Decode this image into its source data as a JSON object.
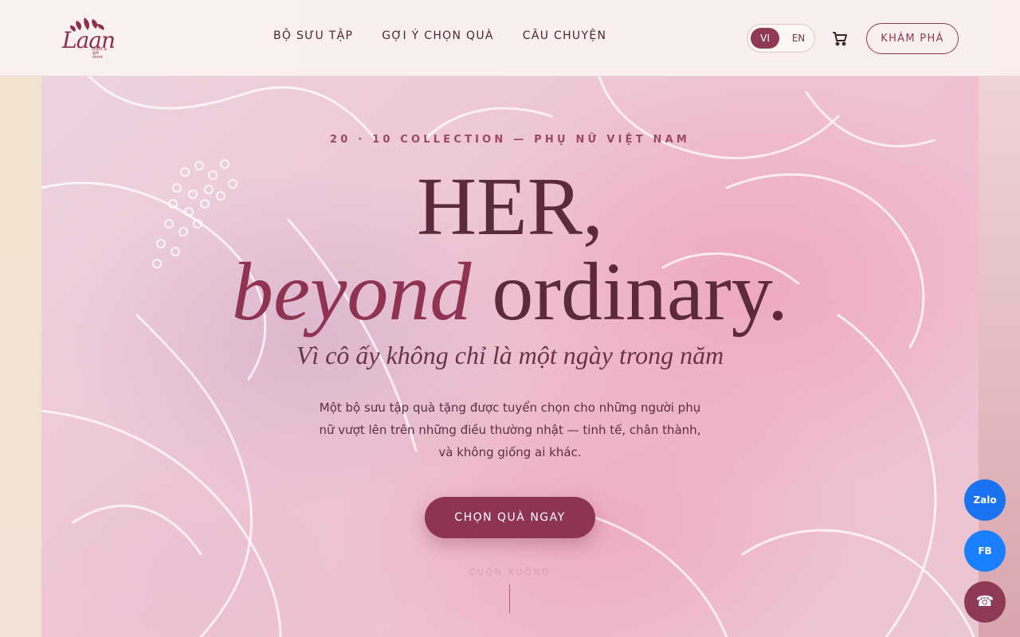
{
  "brand": {
    "name": "Laan",
    "tagline": "plant & gift store"
  },
  "nav": {
    "items": [
      "BỘ SƯU TẬP",
      "GỢI Ý CHỌN QUÀ",
      "CÂU CHUYỆN"
    ]
  },
  "lang": {
    "vi": "VI",
    "en": "EN",
    "active": "VI"
  },
  "header": {
    "explore_label": "KHÁM PHÁ",
    "cart_icon": "cart-icon"
  },
  "hero": {
    "eyebrow": "20 · 10 COLLECTION — PHỤ NỮ VIỆT NAM",
    "title_line1": "HER,",
    "title_italic": "beyond",
    "title_rest": " ordinary.",
    "subtitle": "Vì cô ấy không chỉ là một ngày trong năm",
    "description": "Một bộ sưu tập quà tặng được tuyển chọn cho những người phụ nữ vượt lên trên những điều thường nhật — tinh tế, chân thành, và không giống ai khác.",
    "cta_label": "CHỌN QUÀ NGAY",
    "scroll_label": "CUỘN XUỐNG"
  },
  "floating": {
    "zalo": "Zalo",
    "fb": "FB",
    "phone_icon": "☎"
  },
  "colors": {
    "accent": "#8e3452",
    "text": "#5b2a3c",
    "zalo": "#1a73f0",
    "fb": "#1a80ff"
  }
}
